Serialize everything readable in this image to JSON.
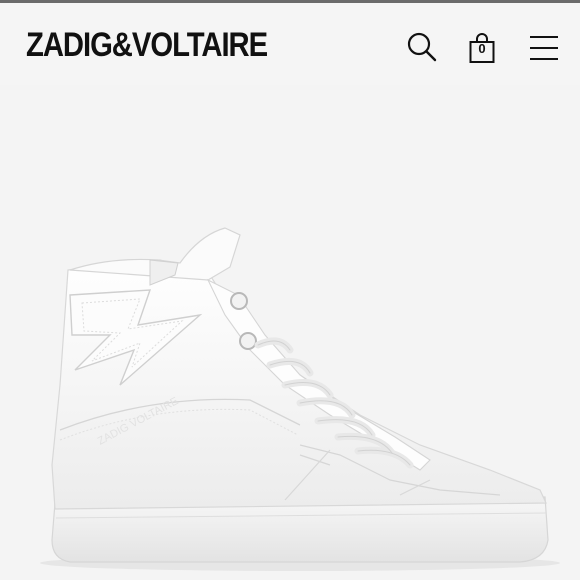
{
  "header": {
    "brand": "ZADIG&VOLTAIRE",
    "bag_count": "0"
  },
  "icons": {
    "search": "search-icon",
    "bag": "shopping-bag-icon",
    "menu": "hamburger-menu-icon"
  },
  "colors": {
    "background": "#f5f5f5",
    "text": "#111111"
  }
}
